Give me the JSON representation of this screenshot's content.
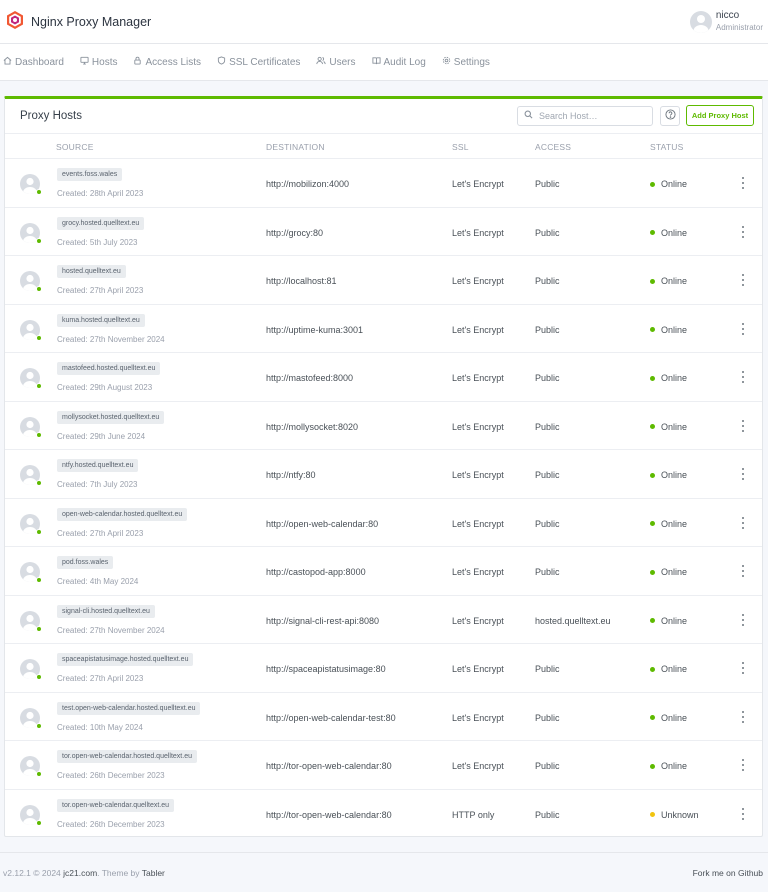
{
  "app": {
    "title": "Nginx Proxy Manager"
  },
  "user": {
    "name": "nicco",
    "role": "Administrator"
  },
  "nav": [
    {
      "label": "Dashboard",
      "icon": "home-icon"
    },
    {
      "label": "Hosts",
      "icon": "monitor-icon"
    },
    {
      "label": "Access Lists",
      "icon": "lock-icon"
    },
    {
      "label": "SSL Certificates",
      "icon": "shield-icon"
    },
    {
      "label": "Users",
      "icon": "users-icon"
    },
    {
      "label": "Audit Log",
      "icon": "book-icon"
    },
    {
      "label": "Settings",
      "icon": "gear-icon"
    }
  ],
  "card": {
    "title": "Proxy Hosts",
    "search_placeholder": "Search Host…",
    "add_label": "Add Proxy Host"
  },
  "columns": {
    "source": "SOURCE",
    "destination": "DESTINATION",
    "ssl": "SSL",
    "access": "ACCESS",
    "status": "STATUS"
  },
  "colors": {
    "accent": "#5eba00",
    "online": "#5eba00",
    "unknown": "#f1c40f"
  },
  "hosts": [
    {
      "domain": "events.foss.wales",
      "created": "Created: 28th April 2023",
      "destination": "http://mobilizon:4000",
      "ssl": "Let's Encrypt",
      "access": "Public",
      "status": "Online"
    },
    {
      "domain": "grocy.hosted.quelltext.eu",
      "created": "Created: 5th July 2023",
      "destination": "http://grocy:80",
      "ssl": "Let's Encrypt",
      "access": "Public",
      "status": "Online"
    },
    {
      "domain": "hosted.quelltext.eu",
      "created": "Created: 27th April 2023",
      "destination": "http://localhost:81",
      "ssl": "Let's Encrypt",
      "access": "Public",
      "status": "Online"
    },
    {
      "domain": "kuma.hosted.quelltext.eu",
      "created": "Created: 27th November 2024",
      "destination": "http://uptime-kuma:3001",
      "ssl": "Let's Encrypt",
      "access": "Public",
      "status": "Online"
    },
    {
      "domain": "mastofeed.hosted.quelltext.eu",
      "created": "Created: 29th August 2023",
      "destination": "http://mastofeed:8000",
      "ssl": "Let's Encrypt",
      "access": "Public",
      "status": "Online"
    },
    {
      "domain": "mollysocket.hosted.quelltext.eu",
      "created": "Created: 29th June 2024",
      "destination": "http://mollysocket:8020",
      "ssl": "Let's Encrypt",
      "access": "Public",
      "status": "Online"
    },
    {
      "domain": "ntfy.hosted.quelltext.eu",
      "created": "Created: 7th July 2023",
      "destination": "http://ntfy:80",
      "ssl": "Let's Encrypt",
      "access": "Public",
      "status": "Online"
    },
    {
      "domain": "open-web-calendar.hosted.quelltext.eu",
      "created": "Created: 27th April 2023",
      "destination": "http://open-web-calendar:80",
      "ssl": "Let's Encrypt",
      "access": "Public",
      "status": "Online"
    },
    {
      "domain": "pod.foss.wales",
      "created": "Created: 4th May 2024",
      "destination": "http://castopod-app:8000",
      "ssl": "Let's Encrypt",
      "access": "Public",
      "status": "Online"
    },
    {
      "domain": "signal-cli.hosted.quelltext.eu",
      "created": "Created: 27th November 2024",
      "destination": "http://signal-cli-rest-api:8080",
      "ssl": "Let's Encrypt",
      "access": "hosted.quelltext.eu",
      "status": "Online"
    },
    {
      "domain": "spaceapistatusimage.hosted.quelltext.eu",
      "created": "Created: 27th April 2023",
      "destination": "http://spaceapistatusimage:80",
      "ssl": "Let's Encrypt",
      "access": "Public",
      "status": "Online"
    },
    {
      "domain": "test.open-web-calendar.hosted.quelltext.eu",
      "created": "Created: 10th May 2024",
      "destination": "http://open-web-calendar-test:80",
      "ssl": "Let's Encrypt",
      "access": "Public",
      "status": "Online"
    },
    {
      "domain": "tor.open-web-calendar.hosted.quelltext.eu",
      "created": "Created: 26th December 2023",
      "destination": "http://tor-open-web-calendar:80",
      "ssl": "Let's Encrypt",
      "access": "Public",
      "status": "Online"
    },
    {
      "domain": "tor.open-web-calendar.quelltext.eu",
      "created": "Created: 26th December 2023",
      "destination": "http://tor-open-web-calendar:80",
      "ssl": "HTTP only",
      "access": "Public",
      "status": "Unknown"
    }
  ],
  "footer": {
    "version": "v2.12.1 © 2024 ",
    "author": "jc21.com",
    "theme_prefix": ". Theme by ",
    "theme": "Tabler",
    "github": "Fork me on Github"
  }
}
